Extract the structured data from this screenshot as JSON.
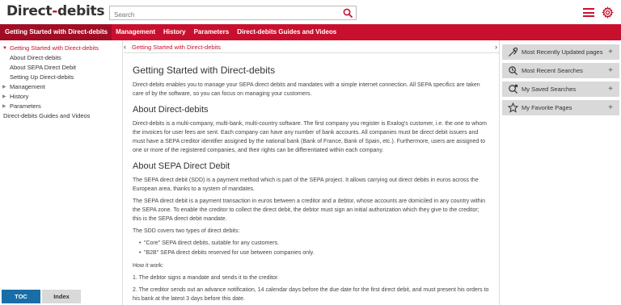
{
  "app": {
    "logo_text": "Direct-debits",
    "accent_color": "#c8102e"
  },
  "search": {
    "placeholder": "Search",
    "icon": "search-icon"
  },
  "header_icons": {
    "menu": "hamburger-menu-icon",
    "settings": "gear-icon"
  },
  "nav": {
    "items": [
      {
        "label": "Getting Started with Direct-debits"
      },
      {
        "label": "Management"
      },
      {
        "label": "History"
      },
      {
        "label": "Parameters"
      },
      {
        "label": "Direct-debits Guides and Videos"
      }
    ]
  },
  "toc": {
    "items": [
      {
        "label": "Getting Started with Direct-debits"
      },
      {
        "label": "About Direct-debits"
      },
      {
        "label": "About SEPA Direct Debit"
      },
      {
        "label": "Setting Up Direct-debits"
      },
      {
        "label": "Management"
      },
      {
        "label": "History"
      },
      {
        "label": "Parameters"
      },
      {
        "label": "Direct-debits Guides and Videos"
      }
    ],
    "tab_toc": "TOC",
    "tab_index": "Index"
  },
  "content": {
    "breadcrumb": "Getting Started with Direct-debits",
    "title": "Getting Started with Direct-debits",
    "intro": "Direct-debits enables you to manage your SEPA direct debits and mandates with a simple internet connection. All SEPA specifics are taken care of by the software, so you can focus on managing your customers.",
    "section1_title": "About Direct-debits",
    "section1_p1": "Direct-debits is a multi-company, multi-bank, multi-country software. The first company you register is Exalog's customer, i.e. the one to whom the invoices for user fees are sent. Each company can have any number of bank accounts. All companies must be direct debit issuers and must have a SEPA creditor identifier assigned by the national bank (Bank of France, Bank of Spain, etc.). Furthermore, users are assigned to one or more of the registered companies, and their rights can be differentiated within each company.",
    "section2_title": "About SEPA Direct Debit",
    "section2_p1": "The SEPA direct debit (SDD) is a payment method which is part of the SEPA project. It allows carrying out direct debits in euros across the European area, thanks to a system of mandates.",
    "section2_p2": "The SEPA direct debit is a payment transaction in euros between a creditor and a debtor, whose accounts are domiciled in any country within the SEPA zone. To enable the creditor to collect the direct debit, the debtor must sign an initial authorization which they give to the creditor; this is the SEPA direct debit mandate.",
    "section2_p3": "The SDD covers two types of direct debits:",
    "bullets": [
      "\"Core\" SEPA direct debits, suitable for any customers.",
      "\"B2B\" SEPA direct debits reserved for use between companies only."
    ],
    "how_it_works": "How it work:",
    "step1": "1. The debtor signs a mandate and sends it to the creditor.",
    "step2": "2. The creditor sends out an advance notification, 14 calendar days before the due date for the first direct debit, and must present his orders to his bank at the latest 3 days before this date."
  },
  "right_panel": {
    "items": [
      {
        "label": "Most Recently Updated pages",
        "icon": "recently-updated-icon"
      },
      {
        "label": "Most Recent Searches",
        "icon": "recent-searches-icon"
      },
      {
        "label": "My Saved Searches",
        "icon": "saved-searches-icon"
      },
      {
        "label": "My Favorite Pages",
        "icon": "star-icon"
      }
    ],
    "expand_symbol": "+"
  }
}
